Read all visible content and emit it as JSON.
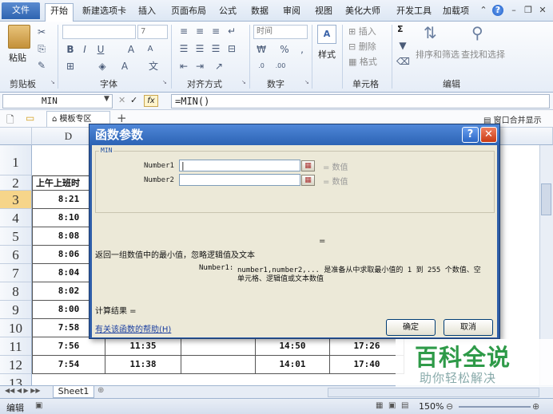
{
  "menu": {
    "file": "文件",
    "tabs": [
      "开始",
      "新建选项卡",
      "插入",
      "页面布局",
      "公式",
      "数据",
      "审阅",
      "视图",
      "美化大师",
      "开发工具",
      "加载项"
    ]
  },
  "ribbon": {
    "clipboard": {
      "paste": "粘贴",
      "label": "剪贴板"
    },
    "font": {
      "label": "字体",
      "size": "7"
    },
    "align": {
      "label": "对齐方式"
    },
    "number": {
      "format": "时间",
      "percent": "%",
      "label": "数字"
    },
    "style": {
      "label": "样式"
    },
    "cells": {
      "insert": "插入",
      "delete": "删除",
      "format": "格式",
      "label": "单元格"
    },
    "editing": {
      "sum": "Σ",
      "sort": "排序和筛选",
      "find": "查找和选择",
      "label": "编辑"
    }
  },
  "formula_bar": {
    "name_box": "MIN",
    "fx": "fx",
    "formula": "=MIN()"
  },
  "doc_bar": {
    "template_tab": "模板专区",
    "add": "+",
    "window_merge": "窗口合并显示"
  },
  "sheet": {
    "col_d": "D",
    "row_numbers": [
      "1",
      "2",
      "3",
      "4",
      "5",
      "6",
      "7",
      "8",
      "9",
      "10",
      "11",
      "12",
      "13"
    ],
    "header_text": "上午上班时",
    "col_d_values": [
      "8:21",
      "8:10",
      "8:08",
      "8:06",
      "8:04",
      "8:02",
      "8:00",
      "7:58",
      "7:56",
      "7:54"
    ],
    "row11": [
      "11:35",
      "14:50",
      "17:26"
    ],
    "row12": [
      "11:38",
      "14:01",
      "17:40"
    ],
    "sheet_tab": "Sheet1"
  },
  "status": {
    "mode": "编辑",
    "zoom": "150%"
  },
  "dialog": {
    "title": "函数参数",
    "function_name": "MIN",
    "arg1_label": "Number1",
    "arg2_label": "Number2",
    "arg_value_hint": "= 数值",
    "arg_value_hint2": "= 数值",
    "result_eq": "=",
    "description": "返回一组数值中的最小值，忽略逻辑值及文本",
    "arg_desc_label": "Number1:",
    "arg_desc_line1": "number1,number2,... 是准备从中求取最小值的 1 到 255 个数值、空",
    "arg_desc_line2": "单元格、逻辑值或文本数值",
    "calc_result": "计算结果 =",
    "help_link": "有关该函数的帮助(H)",
    "ok": "确定",
    "cancel": "取消"
  },
  "watermark": {
    "title": "百科全说",
    "subtitle": "助你轻松解决"
  }
}
